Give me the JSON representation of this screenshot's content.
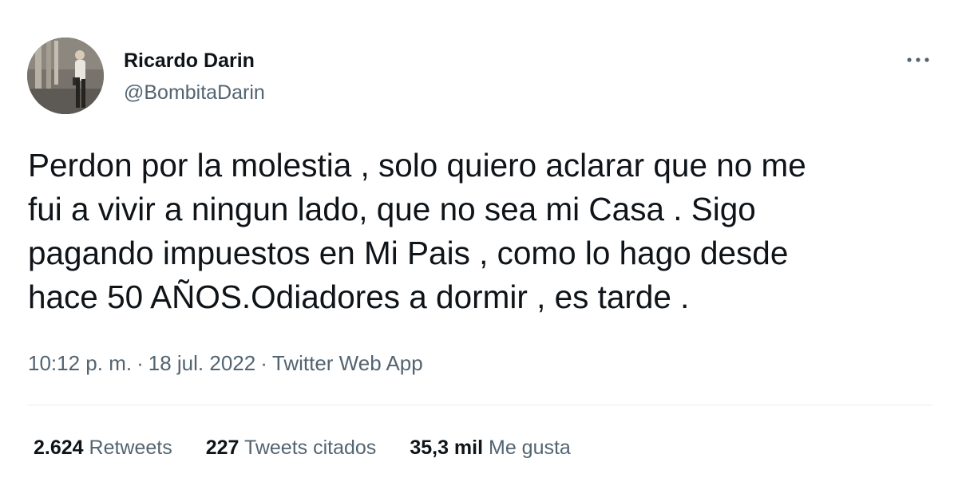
{
  "author": {
    "display_name": "Ricardo Darin",
    "handle": "@BombitaDarin"
  },
  "menu_icon": "more-horizontal-icon",
  "tweet": {
    "lines": [
      "Perdon por la molestia , solo quiero aclarar que no me",
      "fui a vivir a ningun lado, que no sea mi Casa . Sigo",
      "pagando impuestos en Mi Pais , como lo hago desde",
      "hace 50 AÑOS.Odiadores a dormir , es tarde ."
    ]
  },
  "meta": {
    "time": "10:12 p. m.",
    "separator": "·",
    "date": "18 jul. 2022",
    "source": "Twitter Web App"
  },
  "stats": {
    "retweets": {
      "count": "2.624",
      "label": "Retweets"
    },
    "quotes": {
      "count": "227",
      "label": "Tweets citados"
    },
    "likes": {
      "count": "35,3 mil",
      "label": "Me gusta"
    }
  },
  "colors": {
    "text_primary": "#0f1419",
    "text_secondary": "#536471",
    "divider": "#e6ecf0"
  }
}
